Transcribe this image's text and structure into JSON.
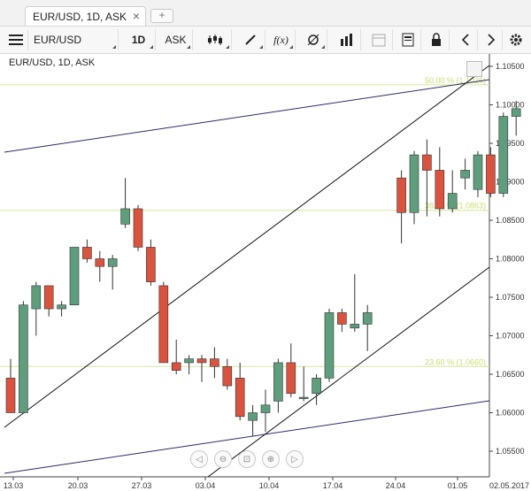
{
  "tab": {
    "title": "EUR/USD, 1D, ASK",
    "close": "×",
    "new": "+"
  },
  "toolbar": {
    "symbol": "EUR/USD",
    "period": "1D",
    "side": "ASK"
  },
  "chart_title": "EUR/USD, 1D, ASK",
  "colors": {
    "up": "#5e9e7d",
    "down": "#d9533f",
    "fib": "#d4e89a",
    "channel": "#2b2b6b"
  },
  "chart_data": {
    "type": "candlestick",
    "y_ticks": [
      "1.10500",
      "1.10000",
      "1.09500",
      "1.09000",
      "1.08500",
      "1.08000",
      "1.07500",
      "1.07000",
      "1.06500",
      "1.06000",
      "1.05500"
    ],
    "y_tick_values": [
      1.105,
      1.1,
      1.095,
      1.09,
      1.085,
      1.08,
      1.075,
      1.07,
      1.065,
      1.06,
      1.055
    ],
    "x_ticks": [
      "13.03",
      "20.03",
      "27.03",
      "03.04",
      "10.04",
      "17.04",
      "24.04",
      "01.05"
    ],
    "x_last": "02.05.2017",
    "fib_levels": [
      {
        "label": "50.00 % (1.1026)",
        "value": 1.1026
      },
      {
        "label": "38.20 % (1.0863)",
        "value": 1.0863
      },
      {
        "label": "23.60 % (1.0660)",
        "value": 1.066
      }
    ],
    "candles": [
      {
        "o": 1.0645,
        "h": 1.067,
        "l": 1.06,
        "c": 1.06
      },
      {
        "o": 1.06,
        "h": 1.0745,
        "l": 1.06,
        "c": 1.074
      },
      {
        "o": 1.0735,
        "h": 1.077,
        "l": 1.07,
        "c": 1.0765
      },
      {
        "o": 1.0765,
        "h": 1.0765,
        "l": 1.0725,
        "c": 1.0735
      },
      {
        "o": 1.0735,
        "h": 1.0745,
        "l": 1.0725,
        "c": 1.074
      },
      {
        "o": 1.074,
        "h": 1.0815,
        "l": 1.074,
        "c": 1.0815
      },
      {
        "o": 1.0815,
        "h": 1.0825,
        "l": 1.0795,
        "c": 1.08
      },
      {
        "o": 1.08,
        "h": 1.081,
        "l": 1.077,
        "c": 1.079
      },
      {
        "o": 1.079,
        "h": 1.0805,
        "l": 1.076,
        "c": 1.08
      },
      {
        "o": 1.0845,
        "h": 1.0905,
        "l": 1.084,
        "c": 1.0865
      },
      {
        "o": 1.0865,
        "h": 1.087,
        "l": 1.081,
        "c": 1.0815
      },
      {
        "o": 1.0815,
        "h": 1.0825,
        "l": 1.0765,
        "c": 1.077
      },
      {
        "o": 1.0765,
        "h": 1.077,
        "l": 1.0665,
        "c": 1.0665
      },
      {
        "o": 1.0665,
        "h": 1.0695,
        "l": 1.065,
        "c": 1.0655
      },
      {
        "o": 1.0665,
        "h": 1.0675,
        "l": 1.065,
        "c": 1.067
      },
      {
        "o": 1.067,
        "h": 1.0675,
        "l": 1.064,
        "c": 1.0665
      },
      {
        "o": 1.067,
        "h": 1.0685,
        "l": 1.0645,
        "c": 1.066
      },
      {
        "o": 1.066,
        "h": 1.067,
        "l": 1.063,
        "c": 1.0635
      },
      {
        "o": 1.0645,
        "h": 1.0665,
        "l": 1.059,
        "c": 1.0595
      },
      {
        "o": 1.059,
        "h": 1.061,
        "l": 1.057,
        "c": 1.06
      },
      {
        "o": 1.06,
        "h": 1.063,
        "l": 1.0575,
        "c": 1.061
      },
      {
        "o": 1.0615,
        "h": 1.067,
        "l": 1.06,
        "c": 1.0665
      },
      {
        "o": 1.0665,
        "h": 1.069,
        "l": 1.062,
        "c": 1.0625
      },
      {
        "o": 1.062,
        "h": 1.066,
        "l": 1.0615,
        "c": 1.062
      },
      {
        "o": 1.0625,
        "h": 1.065,
        "l": 1.061,
        "c": 1.0645
      },
      {
        "o": 1.0645,
        "h": 1.0735,
        "l": 1.064,
        "c": 1.073
      },
      {
        "o": 1.073,
        "h": 1.0735,
        "l": 1.0705,
        "c": 1.0715
      },
      {
        "o": 1.071,
        "h": 1.078,
        "l": 1.0705,
        "c": 1.0715
      },
      {
        "o": 1.0715,
        "h": 1.074,
        "l": 1.068,
        "c": 1.073
      },
      {
        "o": 1.0905,
        "h": 1.0915,
        "l": 1.082,
        "c": 1.086
      },
      {
        "o": 1.086,
        "h": 1.094,
        "l": 1.0845,
        "c": 1.0935
      },
      {
        "o": 1.0935,
        "h": 1.0955,
        "l": 1.0855,
        "c": 1.0915
      },
      {
        "o": 1.0915,
        "h": 1.0945,
        "l": 1.0855,
        "c": 1.0865
      },
      {
        "o": 1.0865,
        "h": 1.0915,
        "l": 1.086,
        "c": 1.0885
      },
      {
        "o": 1.0905,
        "h": 1.093,
        "l": 1.089,
        "c": 1.0915
      },
      {
        "o": 1.089,
        "h": 1.094,
        "l": 1.088,
        "c": 1.0935
      },
      {
        "o": 1.0935,
        "h": 1.0945,
        "l": 1.088,
        "c": 1.0885
      },
      {
        "o": 1.0885,
        "h": 1.099,
        "l": 1.088,
        "c": 1.0985
      },
      {
        "o": 1.0985,
        "h": 1.1005,
        "l": 1.096,
        "c": 1.0995
      }
    ]
  }
}
